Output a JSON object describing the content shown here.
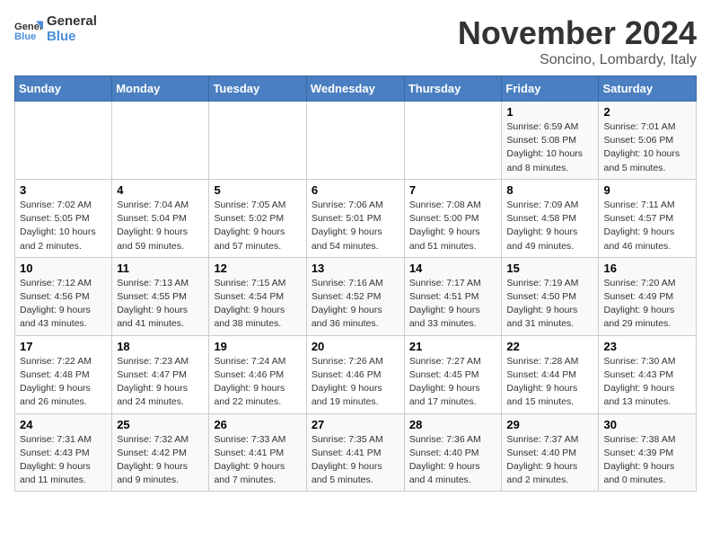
{
  "header": {
    "logo_line1": "General",
    "logo_line2": "Blue",
    "month_title": "November 2024",
    "location": "Soncino, Lombardy, Italy"
  },
  "weekdays": [
    "Sunday",
    "Monday",
    "Tuesday",
    "Wednesday",
    "Thursday",
    "Friday",
    "Saturday"
  ],
  "weeks": [
    [
      {
        "day": "",
        "info": ""
      },
      {
        "day": "",
        "info": ""
      },
      {
        "day": "",
        "info": ""
      },
      {
        "day": "",
        "info": ""
      },
      {
        "day": "",
        "info": ""
      },
      {
        "day": "1",
        "info": "Sunrise: 6:59 AM\nSunset: 5:08 PM\nDaylight: 10 hours and 8 minutes."
      },
      {
        "day": "2",
        "info": "Sunrise: 7:01 AM\nSunset: 5:06 PM\nDaylight: 10 hours and 5 minutes."
      }
    ],
    [
      {
        "day": "3",
        "info": "Sunrise: 7:02 AM\nSunset: 5:05 PM\nDaylight: 10 hours and 2 minutes."
      },
      {
        "day": "4",
        "info": "Sunrise: 7:04 AM\nSunset: 5:04 PM\nDaylight: 9 hours and 59 minutes."
      },
      {
        "day": "5",
        "info": "Sunrise: 7:05 AM\nSunset: 5:02 PM\nDaylight: 9 hours and 57 minutes."
      },
      {
        "day": "6",
        "info": "Sunrise: 7:06 AM\nSunset: 5:01 PM\nDaylight: 9 hours and 54 minutes."
      },
      {
        "day": "7",
        "info": "Sunrise: 7:08 AM\nSunset: 5:00 PM\nDaylight: 9 hours and 51 minutes."
      },
      {
        "day": "8",
        "info": "Sunrise: 7:09 AM\nSunset: 4:58 PM\nDaylight: 9 hours and 49 minutes."
      },
      {
        "day": "9",
        "info": "Sunrise: 7:11 AM\nSunset: 4:57 PM\nDaylight: 9 hours and 46 minutes."
      }
    ],
    [
      {
        "day": "10",
        "info": "Sunrise: 7:12 AM\nSunset: 4:56 PM\nDaylight: 9 hours and 43 minutes."
      },
      {
        "day": "11",
        "info": "Sunrise: 7:13 AM\nSunset: 4:55 PM\nDaylight: 9 hours and 41 minutes."
      },
      {
        "day": "12",
        "info": "Sunrise: 7:15 AM\nSunset: 4:54 PM\nDaylight: 9 hours and 38 minutes."
      },
      {
        "day": "13",
        "info": "Sunrise: 7:16 AM\nSunset: 4:52 PM\nDaylight: 9 hours and 36 minutes."
      },
      {
        "day": "14",
        "info": "Sunrise: 7:17 AM\nSunset: 4:51 PM\nDaylight: 9 hours and 33 minutes."
      },
      {
        "day": "15",
        "info": "Sunrise: 7:19 AM\nSunset: 4:50 PM\nDaylight: 9 hours and 31 minutes."
      },
      {
        "day": "16",
        "info": "Sunrise: 7:20 AM\nSunset: 4:49 PM\nDaylight: 9 hours and 29 minutes."
      }
    ],
    [
      {
        "day": "17",
        "info": "Sunrise: 7:22 AM\nSunset: 4:48 PM\nDaylight: 9 hours and 26 minutes."
      },
      {
        "day": "18",
        "info": "Sunrise: 7:23 AM\nSunset: 4:47 PM\nDaylight: 9 hours and 24 minutes."
      },
      {
        "day": "19",
        "info": "Sunrise: 7:24 AM\nSunset: 4:46 PM\nDaylight: 9 hours and 22 minutes."
      },
      {
        "day": "20",
        "info": "Sunrise: 7:26 AM\nSunset: 4:46 PM\nDaylight: 9 hours and 19 minutes."
      },
      {
        "day": "21",
        "info": "Sunrise: 7:27 AM\nSunset: 4:45 PM\nDaylight: 9 hours and 17 minutes."
      },
      {
        "day": "22",
        "info": "Sunrise: 7:28 AM\nSunset: 4:44 PM\nDaylight: 9 hours and 15 minutes."
      },
      {
        "day": "23",
        "info": "Sunrise: 7:30 AM\nSunset: 4:43 PM\nDaylight: 9 hours and 13 minutes."
      }
    ],
    [
      {
        "day": "24",
        "info": "Sunrise: 7:31 AM\nSunset: 4:43 PM\nDaylight: 9 hours and 11 minutes."
      },
      {
        "day": "25",
        "info": "Sunrise: 7:32 AM\nSunset: 4:42 PM\nDaylight: 9 hours and 9 minutes."
      },
      {
        "day": "26",
        "info": "Sunrise: 7:33 AM\nSunset: 4:41 PM\nDaylight: 9 hours and 7 minutes."
      },
      {
        "day": "27",
        "info": "Sunrise: 7:35 AM\nSunset: 4:41 PM\nDaylight: 9 hours and 5 minutes."
      },
      {
        "day": "28",
        "info": "Sunrise: 7:36 AM\nSunset: 4:40 PM\nDaylight: 9 hours and 4 minutes."
      },
      {
        "day": "29",
        "info": "Sunrise: 7:37 AM\nSunset: 4:40 PM\nDaylight: 9 hours and 2 minutes."
      },
      {
        "day": "30",
        "info": "Sunrise: 7:38 AM\nSunset: 4:39 PM\nDaylight: 9 hours and 0 minutes."
      }
    ]
  ]
}
